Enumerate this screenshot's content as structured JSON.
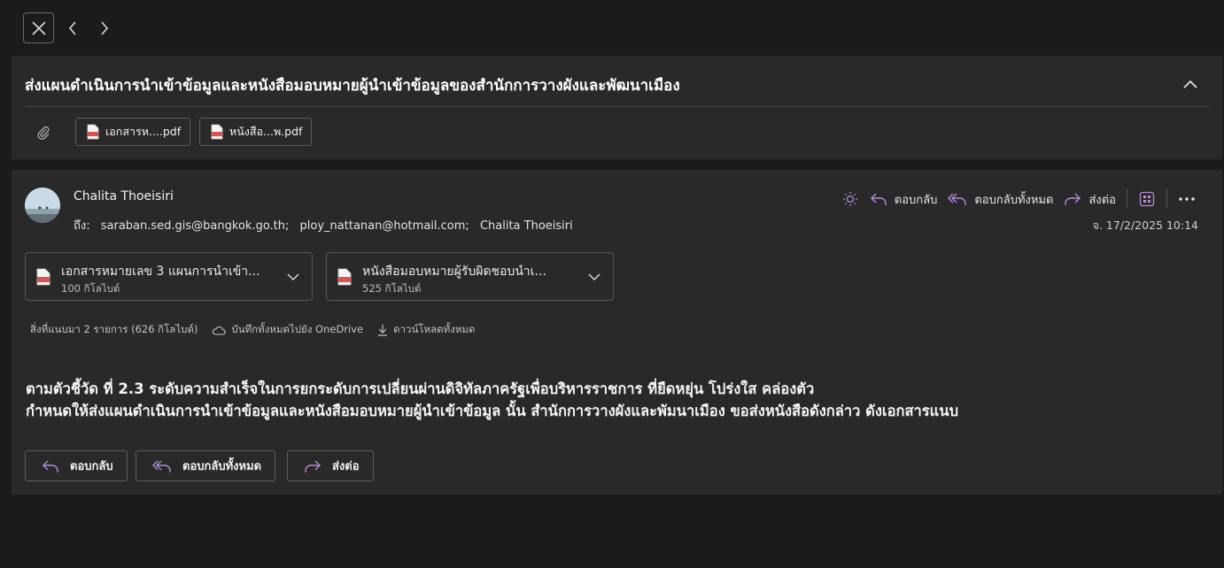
{
  "nav": {
    "close_icon": "close-icon",
    "prev_icon": "chevron-left-icon",
    "next_icon": "chevron-right-icon"
  },
  "subject": {
    "text": "ส่งแผนดำเนินการนำเข้าข้อมูลและหนังสือมอบหมายผู้นำเข้าข้อมูลของสำนักการวางผังและพัฒนาเมือง",
    "attachments": [
      {
        "label": "เอกสารห....pdf",
        "icon": "pdf-icon"
      },
      {
        "label": "หนังสือ...พ.pdf",
        "icon": "pdf-icon"
      }
    ]
  },
  "message": {
    "sender": "Chalita Thoeisiri",
    "to_label": "ถึง:",
    "recipients": [
      "saraban.sed.gis@bangkok.go.th;",
      "ploy_nattanan@hotmail.com;",
      "Chalita Thoeisiri"
    ],
    "date": "จ. 17/2/2025 10:14",
    "actions": {
      "reply": "ตอบกลับ",
      "reply_all": "ตอบกลับทั้งหมด",
      "forward": "ส่งต่อ"
    },
    "attachments": [
      {
        "name": "เอกสารหมายเลข 3 แผนการนำเข้า...",
        "size": "100 กิโลไบต์"
      },
      {
        "name": "หนังสือมอบหมายผู้รับผิดชอบนำเ...",
        "size": "525 กิโลไบต์"
      }
    ],
    "attachment_bar": {
      "summary": "สิ่งที่แนบมา 2 รายการ (626 กิโลไบต์)",
      "save_onedrive": "บันทึกทั้งหมดไปยัง OneDrive",
      "download_all": "ดาวน์โหลดทั้งหมด"
    },
    "body": [
      "ตามตัวชี้วัด ที่ 2.3 ระดับความสำเร็จในการยกระดับการเปลี่ยนผ่านดิจิทัลภาครัฐเพื่อบริหารราชการ ที่ยืดหยุ่น โปร่งใส คล่องตัว",
      "กำหนดให้ส่งแผนดำเนินการนำเข้าข้อมูลและหนังสือมอบหมายผู้นำเข้าข้อมูล นั้น สำนักการวางผังและพัมนาเมือง ขอส่งหนังสือดังกล่าว ดังเอกสารแนบ"
    ]
  },
  "colors": {
    "accent": "#b58ad8",
    "card": "#292929",
    "background": "#1b1b1b",
    "pdf_red": "#d9534f"
  }
}
